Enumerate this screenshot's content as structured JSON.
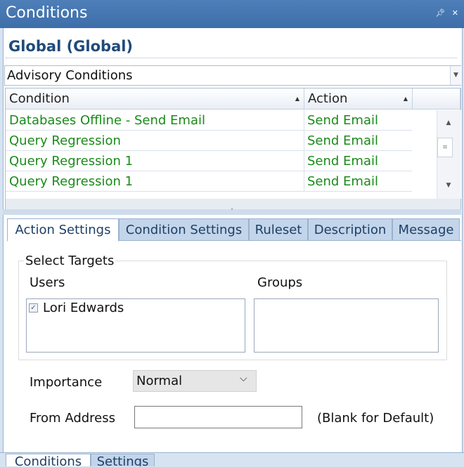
{
  "window": {
    "title": "Conditions",
    "pin_icon": "pin-icon",
    "close_icon": "close-icon"
  },
  "header": {
    "title": "Global (Global)"
  },
  "category_select": {
    "value": "Advisory Conditions"
  },
  "grid": {
    "columns": [
      "Condition",
      "Action"
    ],
    "rows": [
      {
        "condition": "Databases Offline - Send Email",
        "action": "Send Email"
      },
      {
        "condition": "Query Regression",
        "action": "Send Email"
      },
      {
        "condition": "Query Regression 1",
        "action": "Send Email"
      },
      {
        "condition": "Query Regression 1",
        "action": "Send Email"
      }
    ],
    "row_color": "#1a8a1a"
  },
  "tabs": [
    {
      "label": "Action Settings",
      "active": true
    },
    {
      "label": "Condition Settings",
      "active": false
    },
    {
      "label": "Ruleset",
      "active": false
    },
    {
      "label": "Description",
      "active": false
    },
    {
      "label": "Message",
      "active": false
    }
  ],
  "action_settings": {
    "select_targets_label": "Select Targets",
    "users_label": "Users",
    "groups_label": "Groups",
    "users": [
      {
        "name": "Lori Edwards",
        "checked": true
      }
    ],
    "groups": [],
    "importance_label": "Importance",
    "importance_value": "Normal",
    "from_address_label": "From Address",
    "from_address_value": "",
    "from_address_hint": "(Blank for Default)"
  },
  "bottom_tabs": [
    {
      "label": "Conditions",
      "active": true
    },
    {
      "label": "Settings",
      "active": false
    }
  ],
  "colors": {
    "titlebar": "#4575b0",
    "header_text": "#1f4b7a",
    "tab_bg": "#c3d5ea"
  }
}
